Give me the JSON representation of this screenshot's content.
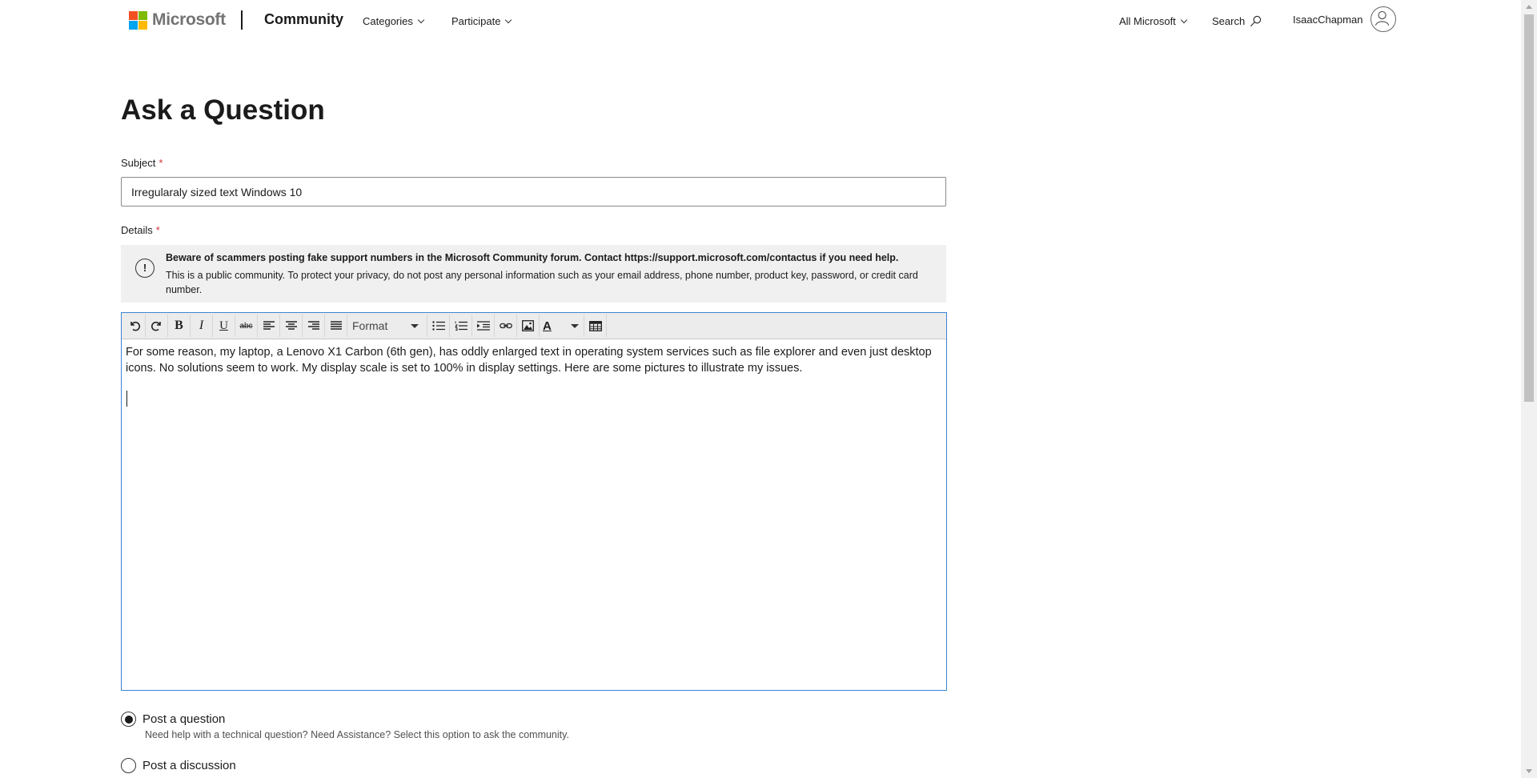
{
  "header": {
    "logo_text": "Microsoft",
    "brand": "Community",
    "nav": [
      {
        "label": "Categories"
      },
      {
        "label": "Participate"
      }
    ],
    "all_microsoft": "All Microsoft",
    "search_label": "Search",
    "user_name": "IsaacChapman",
    "logo_colors": [
      "#f25022",
      "#7fba00",
      "#00a4ef",
      "#ffb900"
    ]
  },
  "page": {
    "title": "Ask a Question"
  },
  "form": {
    "subject_label": "Subject",
    "required_mark": "*",
    "subject_value": "Irregularaly sized text Windows 10",
    "details_label": "Details",
    "notice": {
      "icon": "info-exclamation-icon",
      "bold": "Beware of scammers posting fake support numbers in the Microsoft Community forum. Contact https://support.microsoft.com/contactus if you need help.",
      "text": "This is a public community. To protect your privacy, do not post any personal information such as your email address, phone number, product key, password, or credit card number."
    },
    "editor": {
      "format_label": "Format",
      "toolbar_buttons": [
        "undo-icon",
        "redo-icon",
        "bold",
        "italic",
        "underline",
        "strikethrough",
        "align-left",
        "align-center",
        "align-right",
        "justify",
        "format",
        "bullet-list",
        "numbered-list",
        "indent",
        "link",
        "image",
        "text-color",
        "table"
      ],
      "bold_glyph": "B",
      "italic_glyph": "I",
      "underline_glyph": "U",
      "strike_glyph": "abc",
      "text_color_glyph": "A",
      "content": "For some reason, my laptop, a Lenovo X1 Carbon (6th gen), has oddly enlarged text in operating system services such as file explorer and even just desktop icons. No solutions seem to work. My display scale is set to 100% in display settings. Here are some pictures to illustrate my issues."
    },
    "post_type": {
      "question_label": "Post a question",
      "question_desc": "Need help with a technical question? Need Assistance? Select this option to ask the community.",
      "discussion_label": "Post a discussion",
      "selected": "question"
    }
  }
}
